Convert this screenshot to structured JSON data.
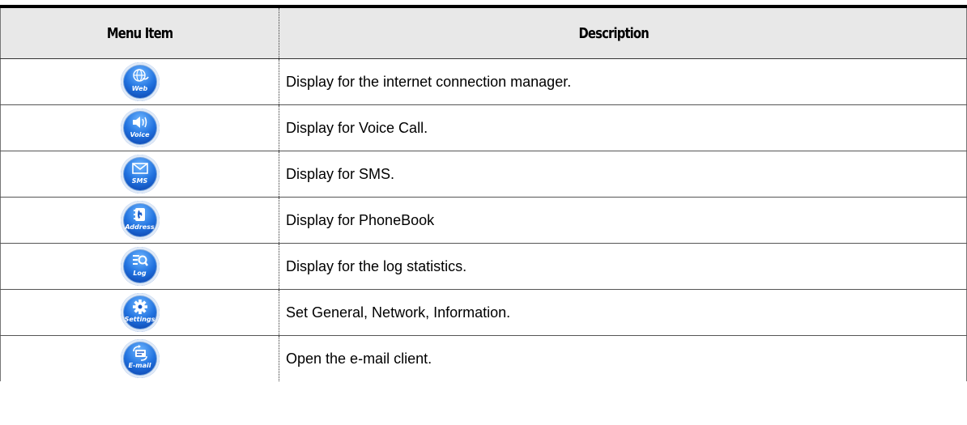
{
  "table": {
    "headers": [
      "Menu Item",
      "Description"
    ],
    "rows": [
      {
        "icon": "web-icon",
        "icon_label": "Web",
        "description": "Display for the internet connection manager."
      },
      {
        "icon": "voice-icon",
        "icon_label": "Voice",
        "description": "Display for Voice Call."
      },
      {
        "icon": "sms-icon",
        "icon_label": "SMS",
        "description": "Display for SMS."
      },
      {
        "icon": "address-icon",
        "icon_label": "Address",
        "description": "Display for PhoneBook"
      },
      {
        "icon": "log-icon",
        "icon_label": "Log",
        "description": "Display for the log statistics."
      },
      {
        "icon": "settings-icon",
        "icon_label": "Settings",
        "description": "Set General, Network, Information."
      },
      {
        "icon": "email-icon",
        "icon_label": "E-mail",
        "description": "Open the e-mail client."
      }
    ]
  },
  "colors": {
    "icon_blue": "#2173e0",
    "header_bg": "#e8e8e8"
  }
}
